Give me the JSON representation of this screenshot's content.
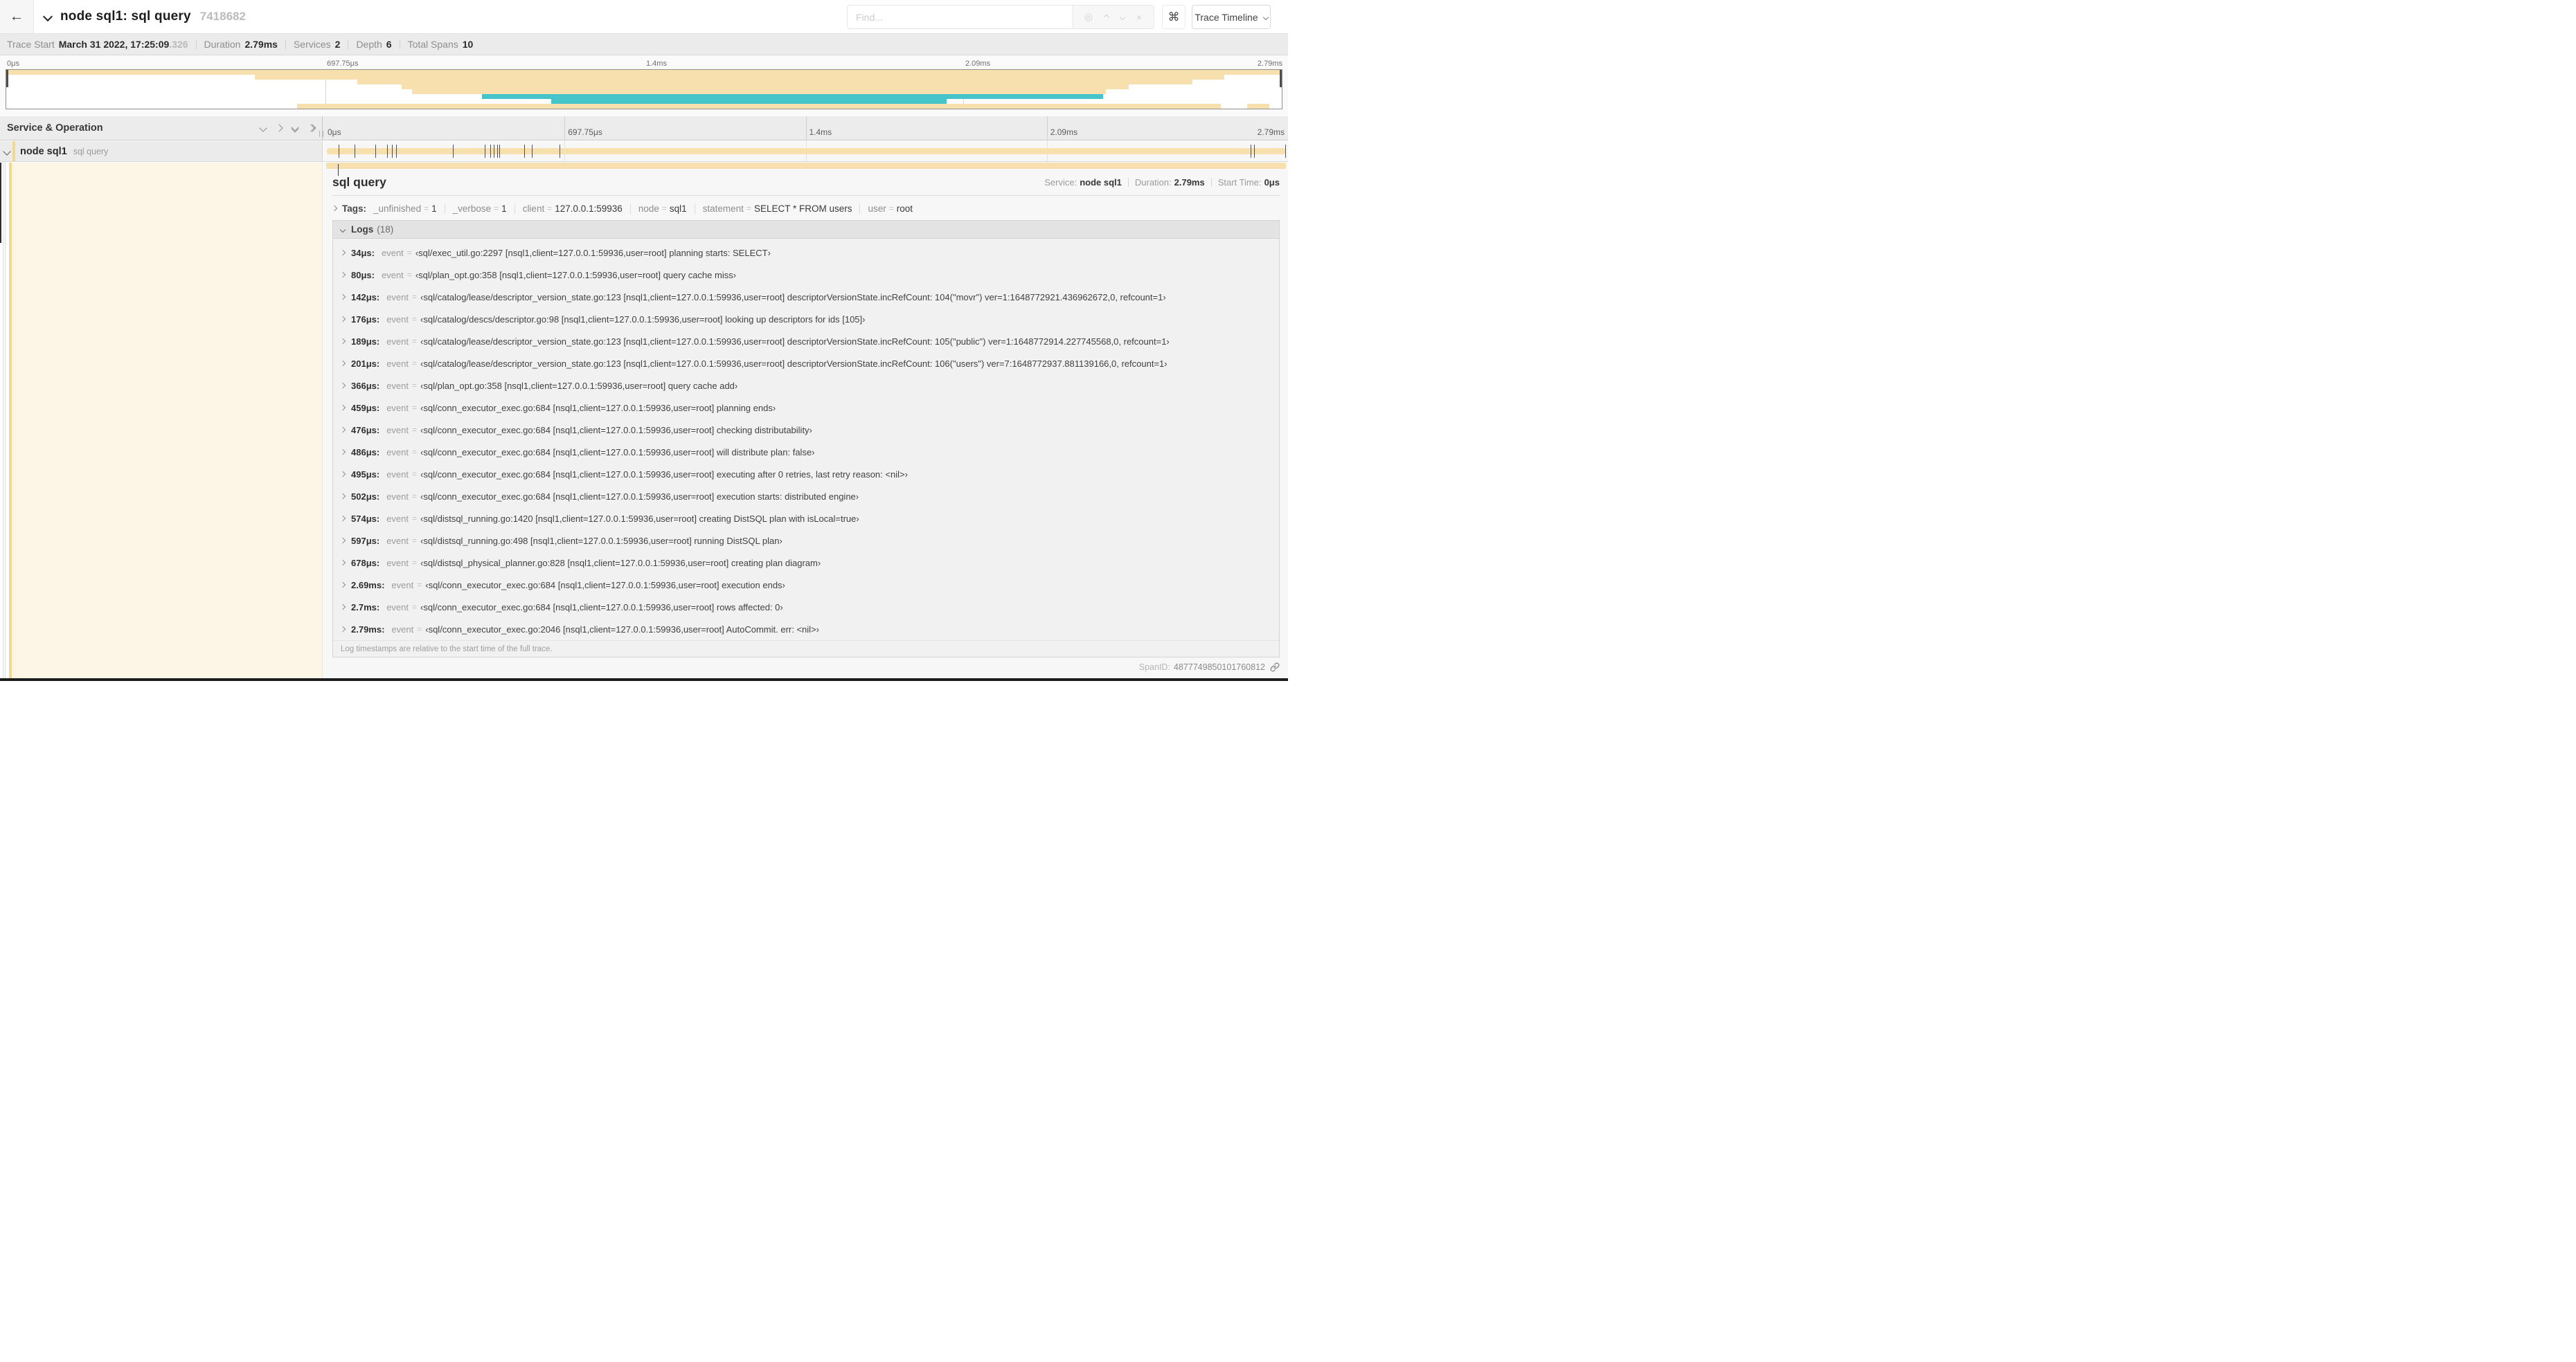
{
  "icons": {
    "back": "←",
    "locate": "◎",
    "clear": "×",
    "command": "⌘"
  },
  "header": {
    "title": "node sql1: sql query",
    "trace_id": "7418682",
    "find": {
      "placeholder": "Find..."
    },
    "view_button": "Trace Timeline"
  },
  "summary": {
    "items": [
      {
        "label": "Trace Start",
        "value": "March 31 2022, 17:25:09",
        "suffix": ".326"
      },
      {
        "label": "Duration",
        "value": "2.79ms"
      },
      {
        "label": "Services",
        "value": "2"
      },
      {
        "label": "Depth",
        "value": "6"
      },
      {
        "label": "Total Spans",
        "value": "10"
      }
    ]
  },
  "timeline": {
    "duration_us": 2790,
    "ticks": [
      "0μs",
      "697.75μs",
      "1.4ms",
      "2.09ms",
      "2.79ms"
    ],
    "left_header": "Service & Operation"
  },
  "minimap": {
    "spans": [
      {
        "row": 0,
        "start": 0,
        "end": 1.0,
        "color": "#f7e0ad"
      },
      {
        "row": 1,
        "start": 0.195,
        "end": 0.955,
        "color": "#f7e0ad"
      },
      {
        "row": 2,
        "start": 0.275,
        "end": 0.93,
        "color": "#f7e0ad"
      },
      {
        "row": 3,
        "start": 0.31,
        "end": 0.88,
        "color": "#f7e0ad"
      },
      {
        "row": 4,
        "start": 0.318,
        "end": 0.862,
        "color": "#f7e0ad"
      },
      {
        "row": 5,
        "start": 0.373,
        "end": 0.86,
        "color": "#45c5c9"
      },
      {
        "row": 6,
        "start": 0.427,
        "end": 0.737,
        "color": "#45c5c9"
      },
      {
        "row": 7,
        "start": 0.228,
        "end": 0.952,
        "color": "#f7e0ad"
      },
      {
        "row": 7,
        "start": 0.973,
        "end": 0.99,
        "color": "#f7e0ad"
      }
    ]
  },
  "row": {
    "service": "node sql1",
    "operation": "sql query"
  },
  "detail": {
    "title": "sql query",
    "meta": [
      {
        "label": "Service:",
        "value": "node sql1"
      },
      {
        "label": "Duration:",
        "value": "2.79ms"
      },
      {
        "label": "Start Time:",
        "value": "0μs"
      }
    ],
    "tags_label": "Tags:",
    "tags": [
      {
        "key": "_unfinished",
        "value": "1"
      },
      {
        "key": "_verbose",
        "value": "1"
      },
      {
        "key": "client",
        "value": "127.0.0.1:59936"
      },
      {
        "key": "node",
        "value": "sql1"
      },
      {
        "key": "statement",
        "value": "SELECT * FROM users"
      },
      {
        "key": "user",
        "value": "root"
      }
    ],
    "logs_label": "Logs",
    "logs_count": "(18)",
    "event_key": "event",
    "logs": [
      {
        "time": "34μs:",
        "t": 34,
        "value": "‹sql/exec_util.go:2297 [nsql1,client=127.0.0.1:59936,user=root] planning starts: SELECT›"
      },
      {
        "time": "80μs:",
        "t": 80,
        "value": "‹sql/plan_opt.go:358 [nsql1,client=127.0.0.1:59936,user=root] query cache miss›"
      },
      {
        "time": "142μs:",
        "t": 142,
        "value": "‹sql/catalog/lease/descriptor_version_state.go:123 [nsql1,client=127.0.0.1:59936,user=root] descriptorVersionState.incRefCount: 104(\"movr\") ver=1:1648772921.436962672,0, refcount=1›"
      },
      {
        "time": "176μs:",
        "t": 176,
        "value": "‹sql/catalog/descs/descriptor.go:98 [nsql1,client=127.0.0.1:59936,user=root] looking up descriptors for ids [105]›"
      },
      {
        "time": "189μs:",
        "t": 189,
        "value": "‹sql/catalog/lease/descriptor_version_state.go:123 [nsql1,client=127.0.0.1:59936,user=root] descriptorVersionState.incRefCount: 105(\"public\") ver=1:1648772914.227745568,0, refcount=1›"
      },
      {
        "time": "201μs:",
        "t": 201,
        "value": "‹sql/catalog/lease/descriptor_version_state.go:123 [nsql1,client=127.0.0.1:59936,user=root] descriptorVersionState.incRefCount: 106(\"users\") ver=7:1648772937.881139166,0, refcount=1›"
      },
      {
        "time": "366μs:",
        "t": 366,
        "value": "‹sql/plan_opt.go:358 [nsql1,client=127.0.0.1:59936,user=root] query cache add›"
      },
      {
        "time": "459μs:",
        "t": 459,
        "value": "‹sql/conn_executor_exec.go:684 [nsql1,client=127.0.0.1:59936,user=root] planning ends›"
      },
      {
        "time": "476μs:",
        "t": 476,
        "value": "‹sql/conn_executor_exec.go:684 [nsql1,client=127.0.0.1:59936,user=root] checking distributability›"
      },
      {
        "time": "486μs:",
        "t": 486,
        "value": "‹sql/conn_executor_exec.go:684 [nsql1,client=127.0.0.1:59936,user=root] will distribute plan: false›"
      },
      {
        "time": "495μs:",
        "t": 495,
        "value": "‹sql/conn_executor_exec.go:684 [nsql1,client=127.0.0.1:59936,user=root] executing after 0 retries, last retry reason: <nil>›"
      },
      {
        "time": "502μs:",
        "t": 502,
        "value": "‹sql/conn_executor_exec.go:684 [nsql1,client=127.0.0.1:59936,user=root] execution starts: distributed engine›"
      },
      {
        "time": "574μs:",
        "t": 574,
        "value": "‹sql/distsql_running.go:1420 [nsql1,client=127.0.0.1:59936,user=root] creating DistSQL plan with isLocal=true›"
      },
      {
        "time": "597μs:",
        "t": 597,
        "value": "‹sql/distsql_running.go:498 [nsql1,client=127.0.0.1:59936,user=root] running DistSQL plan›"
      },
      {
        "time": "678μs:",
        "t": 678,
        "value": "‹sql/distsql_physical_planner.go:828 [nsql1,client=127.0.0.1:59936,user=root] creating plan diagram›"
      },
      {
        "time": "2.69ms:",
        "t": 2690,
        "value": "‹sql/conn_executor_exec.go:684 [nsql1,client=127.0.0.1:59936,user=root] execution ends›"
      },
      {
        "time": "2.7ms:",
        "t": 2700,
        "value": "‹sql/conn_executor_exec.go:684 [nsql1,client=127.0.0.1:59936,user=root] rows affected: 0›"
      },
      {
        "time": "2.79ms:",
        "t": 2790,
        "value": "‹sql/conn_executor_exec.go:2046 [nsql1,client=127.0.0.1:59936,user=root] AutoCommit. err: <nil>›"
      }
    ],
    "note": "Log timestamps are relative to the start time of the full trace.",
    "span_id_label": "SpanID:",
    "span_id": "4877749850101760812"
  }
}
